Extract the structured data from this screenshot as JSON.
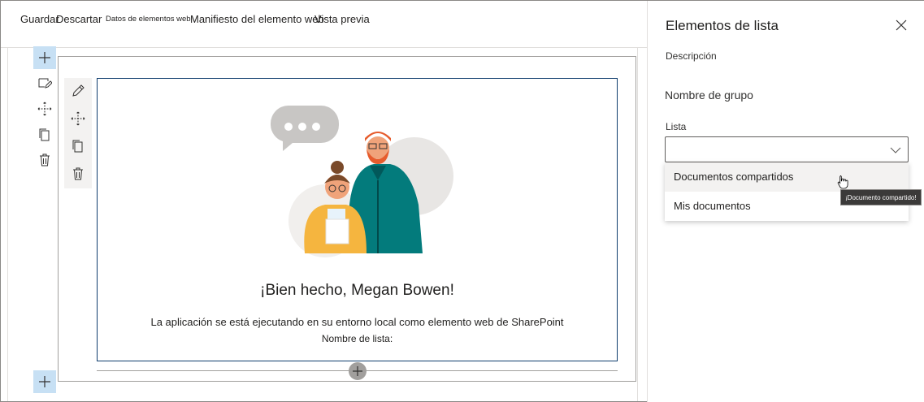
{
  "toolbar": {
    "save": "Guardar",
    "discard": "Descartar",
    "webpart_data": "Datos de elementos web",
    "manifest": "Manifiesto del elemento web",
    "preview": "Vista previa"
  },
  "webpart": {
    "greeting": "¡Bien hecho, Megan Bowen!",
    "description": "La aplicación se está ejecutando en su entorno local como elemento web de SharePoint",
    "list_name_label": "Nombre de lista:"
  },
  "pane": {
    "title": "Elementos de lista",
    "description": "Descripción",
    "group_name": "Nombre de grupo",
    "list_label": "Lista",
    "dropdown_value": "",
    "options": [
      "Documentos compartidos",
      "Mis documentos"
    ],
    "hovered_option": "Documentos compartidos",
    "tooltip": "¡Documento compartido!"
  },
  "colors": {
    "accent_light": "#c7e0f4",
    "webpart_border": "#0f3d6e",
    "tooltip_bg": "#3b3a39"
  },
  "icons": [
    "add-icon",
    "edit-icon",
    "move-icon",
    "copy-icon",
    "delete-icon",
    "close-icon",
    "chevron-down-icon",
    "hand-cursor-icon"
  ]
}
